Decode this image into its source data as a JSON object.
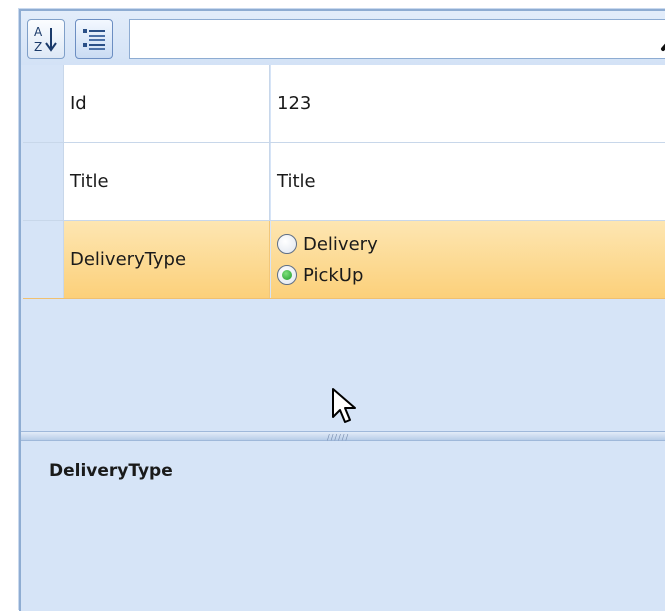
{
  "toolbar": {
    "sort_icon": "sort-alphabetical-icon",
    "categorize_icon": "categorize-icon",
    "search": {
      "value": "",
      "placeholder": "",
      "icon": "search-icon"
    }
  },
  "properties": [
    {
      "name": "Id",
      "value": "123"
    },
    {
      "name": "Title",
      "value": "Title"
    },
    {
      "name": "DeliveryType",
      "options": [
        "Delivery",
        "PickUp"
      ],
      "selected": "PickUp"
    }
  ],
  "description": {
    "title": "DeliveryType"
  },
  "colors": {
    "panel_background": "#d6e4f7",
    "selected_row": "#fcd07a",
    "border": "#8eacd2",
    "radio_checked": "#1f9a28"
  }
}
